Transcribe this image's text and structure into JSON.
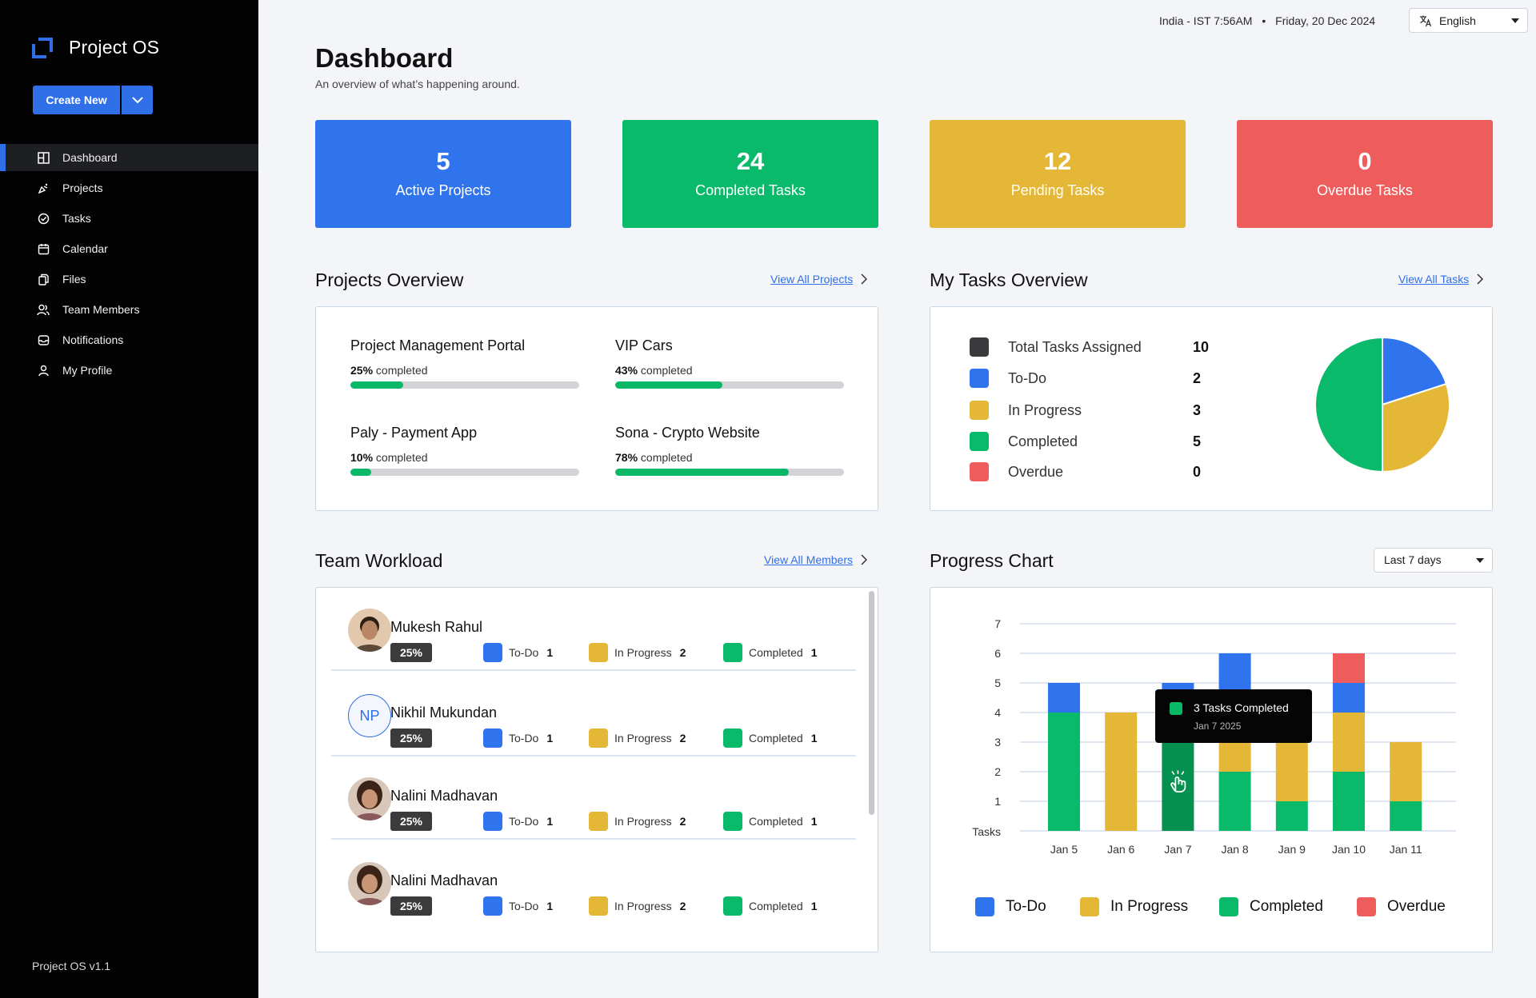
{
  "app": {
    "name": "Project OS",
    "version": "Project OS v1.1"
  },
  "create": {
    "label": "Create New"
  },
  "nav": [
    {
      "label": "Dashboard",
      "icon": "dashboard-icon",
      "active": true
    },
    {
      "label": "Projects",
      "icon": "projects-icon"
    },
    {
      "label": "Tasks",
      "icon": "tasks-icon"
    },
    {
      "label": "Calendar",
      "icon": "calendar-icon"
    },
    {
      "label": "Files",
      "icon": "files-icon"
    },
    {
      "label": "Team Members",
      "icon": "team-icon"
    },
    {
      "label": "Notifications",
      "icon": "notifications-icon"
    },
    {
      "label": "My Profile",
      "icon": "profile-icon"
    }
  ],
  "topbar": {
    "location_time": "India - IST 7:56AM",
    "separator": "•",
    "date": "Friday, 20 Dec 2024",
    "language": "English"
  },
  "header": {
    "title": "Dashboard",
    "subtitle": "An overview of what’s happening around."
  },
  "stats": [
    {
      "value": "5",
      "label": "Active Projects",
      "color": "#2f74ed"
    },
    {
      "value": "24",
      "label": "Completed Tasks",
      "color": "#08ba6a"
    },
    {
      "value": "12",
      "label": "Pending Tasks",
      "color": "#e4b736"
    },
    {
      "value": "0",
      "label": "Overdue Tasks",
      "color": "#ef5c5c"
    }
  ],
  "projects_overview": {
    "title": "Projects Overview",
    "link": "View All Projects",
    "completed_label": "completed",
    "projects": [
      {
        "name": "Project Management Portal",
        "percent": "25%",
        "progress": 0.23
      },
      {
        "name": "VIP Cars",
        "percent": "43%",
        "progress": 0.47
      },
      {
        "name": "Paly - Payment App",
        "percent": "10%",
        "progress": 0.09
      },
      {
        "name": "Sona - Crypto Website",
        "percent": "78%",
        "progress": 0.76
      }
    ]
  },
  "tasks_overview": {
    "title": "My Tasks Overview",
    "link": "View All Tasks",
    "rows": [
      {
        "label": "Total Tasks Assigned",
        "value": "10",
        "color": "#3a3a3c"
      },
      {
        "label": "To-Do",
        "value": "2",
        "color": "#2f74ed"
      },
      {
        "label": "In Progress",
        "value": "3",
        "color": "#e4b736"
      },
      {
        "label": "Completed",
        "value": "5",
        "color": "#08ba6a"
      },
      {
        "label": "Overdue",
        "value": "0",
        "color": "#ef5c5c"
      }
    ],
    "pie": [
      {
        "name": "To-Do",
        "value": 2,
        "color": "#2f74ed"
      },
      {
        "name": "In Progress",
        "value": 3,
        "color": "#e4b736"
      },
      {
        "name": "Completed",
        "value": 5,
        "color": "#08ba6a"
      }
    ]
  },
  "team_workload": {
    "title": "Team Workload",
    "link": "View All Members",
    "todo_label": "To-Do",
    "inprogress_label": "In Progress",
    "completed_label": "Completed",
    "members": [
      {
        "name": "Mukesh Rahul",
        "badge": "25%",
        "todo": "1",
        "inprogress": "2",
        "completed": "1",
        "avatar": "photo"
      },
      {
        "name": "Nikhil Mukundan",
        "badge": "25%",
        "todo": "1",
        "inprogress": "2",
        "completed": "1",
        "avatar": "initials",
        "initials": "NP"
      },
      {
        "name": "Nalini Madhavan",
        "badge": "25%",
        "todo": "1",
        "inprogress": "2",
        "completed": "1",
        "avatar": "photo"
      },
      {
        "name": "Nalini Madhavan",
        "badge": "25%",
        "todo": "1",
        "inprogress": "2",
        "completed": "1",
        "avatar": "photo"
      }
    ]
  },
  "progress_chart": {
    "title": "Progress Chart",
    "range": "Last 7 days",
    "tooltip": {
      "title": "3 Tasks Completed",
      "subtitle": "Jan 7 2025"
    },
    "legend": [
      {
        "label": "To-Do",
        "color": "#2f74ed"
      },
      {
        "label": "In Progress",
        "color": "#e4b736"
      },
      {
        "label": "Completed",
        "color": "#08ba6a"
      },
      {
        "label": "Overdue",
        "color": "#ef5c5c"
      }
    ]
  },
  "chart_data": {
    "type": "bar",
    "stacked": true,
    "categories": [
      "Jan 5",
      "Jan 6",
      "Jan 7",
      "Jan 8",
      "Jan 9",
      "Jan 10",
      "Jan 11"
    ],
    "series": [
      {
        "name": "Completed",
        "color": "#08ba6a",
        "values": [
          4,
          0,
          3,
          2,
          1,
          2,
          1
        ]
      },
      {
        "name": "In Progress",
        "color": "#e4b736",
        "values": [
          0,
          4,
          1,
          2,
          3,
          2,
          2
        ]
      },
      {
        "name": "To-Do",
        "color": "#2f74ed",
        "values": [
          1,
          0,
          1,
          2,
          0,
          1,
          0
        ]
      },
      {
        "name": "Overdue",
        "color": "#ef5c5c",
        "values": [
          0,
          0,
          0,
          0,
          0,
          1,
          0
        ]
      }
    ],
    "yticks": [
      "1",
      "2",
      "3",
      "4",
      "5",
      "6",
      "7"
    ],
    "ylabel": "Tasks",
    "ylim": [
      0,
      7
    ],
    "grid": true,
    "legend": "bottom"
  }
}
